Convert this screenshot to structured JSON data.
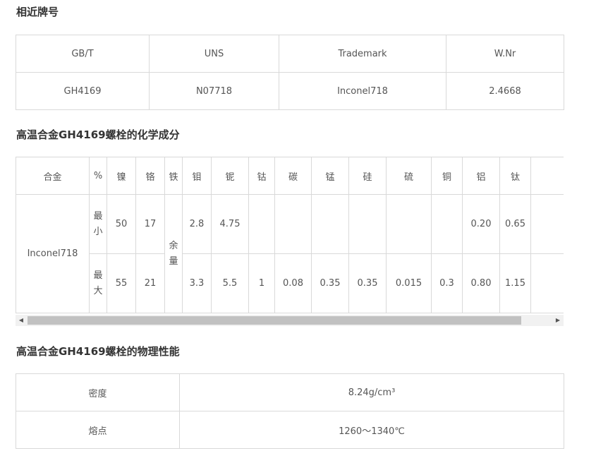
{
  "sections": {
    "similar": "相近牌号",
    "chem": "高温合金GH4169螺栓的化学成分",
    "phys": "高温合金GH4169螺栓的物理性能"
  },
  "grades": {
    "headers": [
      "GB/T",
      "UNS",
      "Trademark",
      "W.Nr"
    ],
    "values": [
      "GH4169",
      "N07718",
      "Inconel718",
      "2.4668"
    ]
  },
  "chem": {
    "headers": [
      "合金",
      "%",
      "镍",
      "铬",
      "铁",
      "钼",
      "铌",
      "钴",
      "碳",
      "锰",
      "硅",
      "硫",
      "铜",
      "铝",
      "钛"
    ],
    "alloy": "Inconel718",
    "min_label": "最小",
    "max_label": "最大",
    "iron_balance": "余量",
    "min": {
      "ni": "50",
      "cr": "17",
      "mo": "2.8",
      "nb": "4.75",
      "al": "0.20",
      "ti": "0.65"
    },
    "max": {
      "ni": "55",
      "cr": "21",
      "mo": "3.3",
      "nb": "5.5",
      "co": "1",
      "c": "0.08",
      "mn": "0.35",
      "si": "0.35",
      "s": "0.015",
      "cu": "0.3",
      "al": "0.80",
      "ti": "1.15"
    }
  },
  "scrollbar": {
    "left_arrow": "◀",
    "right_arrow": "▶"
  },
  "phys": {
    "density_label": "密度",
    "density_value": "8.24g/cm³",
    "melting_label": "熔点",
    "melting_value": "1260～1340℃"
  }
}
